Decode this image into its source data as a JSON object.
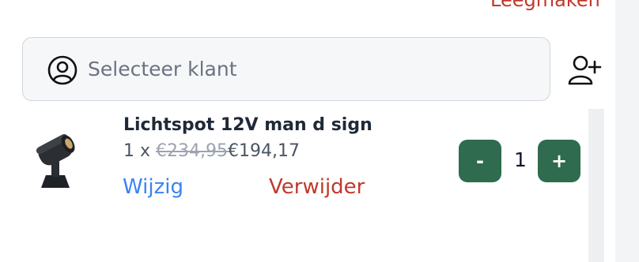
{
  "cart": {
    "clear_label": "Leegmaken"
  },
  "customer": {
    "placeholder": "Selecteer klant",
    "icon": "user-circle-icon",
    "add_icon": "user-plus-icon"
  },
  "item": {
    "name": "Lichtspot 12V man d sign",
    "quantity_prefix": "1 x",
    "original_price": "€234,95",
    "price": "€194,17",
    "edit_label": "Wijzig",
    "remove_label": "Verwijder",
    "quantity": "1",
    "minus_label": "-",
    "plus_label": "+"
  },
  "colors": {
    "accent_green": "#2e6b4f",
    "danger_red": "#c0392b",
    "link_blue": "#3b82f6"
  }
}
